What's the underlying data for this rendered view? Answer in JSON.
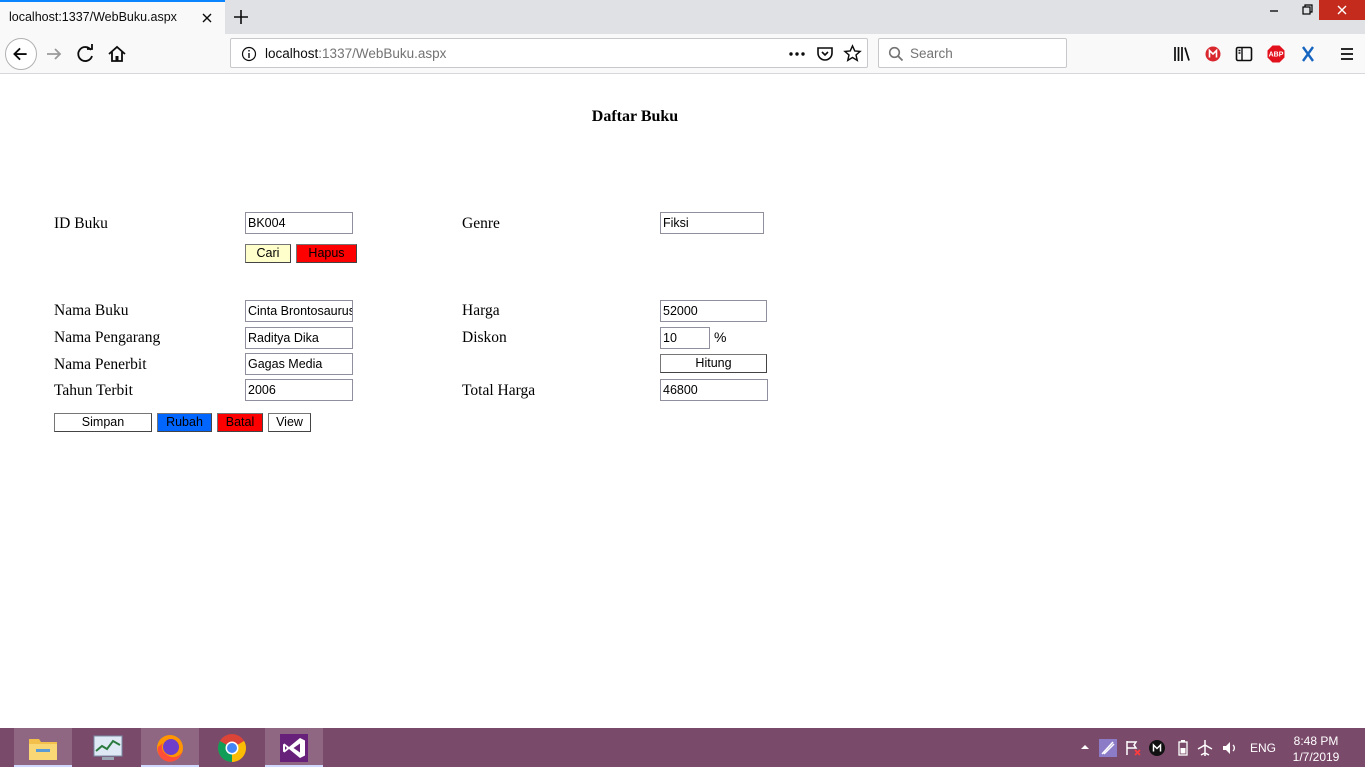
{
  "browser": {
    "tab_title": "localhost:1337/WebBuku.aspx",
    "url_host": "localhost",
    "url_path": ":1337/WebBuku.aspx",
    "search_placeholder": "Search"
  },
  "page": {
    "title": "Daftar Buku",
    "labels": {
      "id_buku": "ID Buku",
      "genre": "Genre",
      "nama_buku": "Nama Buku",
      "harga": "Harga",
      "nama_pengarang": "Nama Pengarang",
      "diskon": "Diskon",
      "nama_penerbit": "Nama Penerbit",
      "tahun_terbit": "Tahun Terbit",
      "total_harga": "Total Harga",
      "percent": "%"
    },
    "fields": {
      "id_buku": "BK004",
      "genre": "Fiksi",
      "nama_buku": "Cinta Brontosaurus",
      "harga": "52000",
      "nama_pengarang": "Raditya Dika",
      "diskon": "10",
      "nama_penerbit": "Gagas Media",
      "tahun_terbit": "2006",
      "total_harga": "46800"
    },
    "buttons": {
      "cari": "Cari",
      "hapus": "Hapus",
      "hitung": "Hitung",
      "simpan": "Simpan",
      "rubah": "Rubah",
      "batal": "Batal",
      "view": "View"
    },
    "button_colors": {
      "cari": "#ffffcc",
      "hapus": "#ff0000",
      "rubah": "#0066ff",
      "batal": "#ff0000"
    }
  },
  "taskbar": {
    "apps": [
      "file-explorer-icon",
      "task-manager-icon",
      "firefox-icon",
      "chrome-icon",
      "visual-studio-icon"
    ],
    "language": "ENG",
    "time": "8:48 PM",
    "date": "1/7/2019"
  }
}
